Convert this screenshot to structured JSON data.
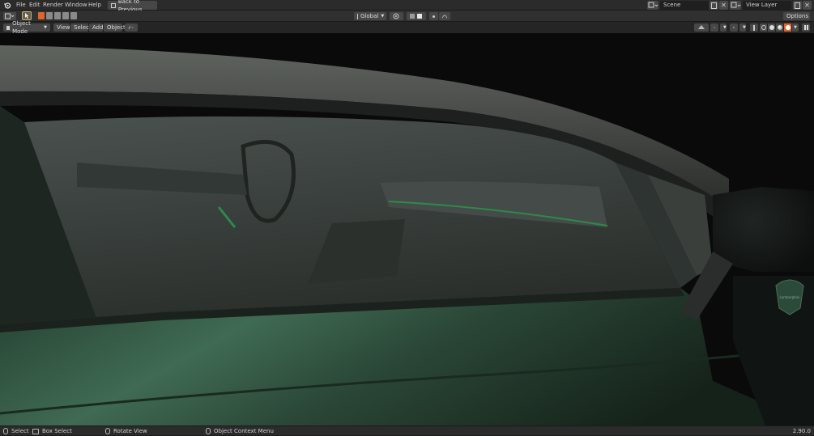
{
  "menu": {
    "file": "File",
    "edit": "Edit",
    "render": "Render",
    "window": "Window",
    "help": "Help",
    "back": "Back to Previous"
  },
  "scene": {
    "name": "Scene"
  },
  "view_layer": {
    "name": "View Layer"
  },
  "toolbar": {
    "transform_orientation": "Global",
    "options": "Options"
  },
  "header": {
    "mode": "Object Mode",
    "view": "View",
    "select": "Select",
    "add": "Add",
    "object": "Object"
  },
  "status": {
    "select": "Select",
    "box_select": "Box Select",
    "rotate_view": "Rotate View",
    "context_menu": "Object Context Menu",
    "version": "2.90.0"
  },
  "viewport": {
    "badge_text": "Lamborghini"
  }
}
